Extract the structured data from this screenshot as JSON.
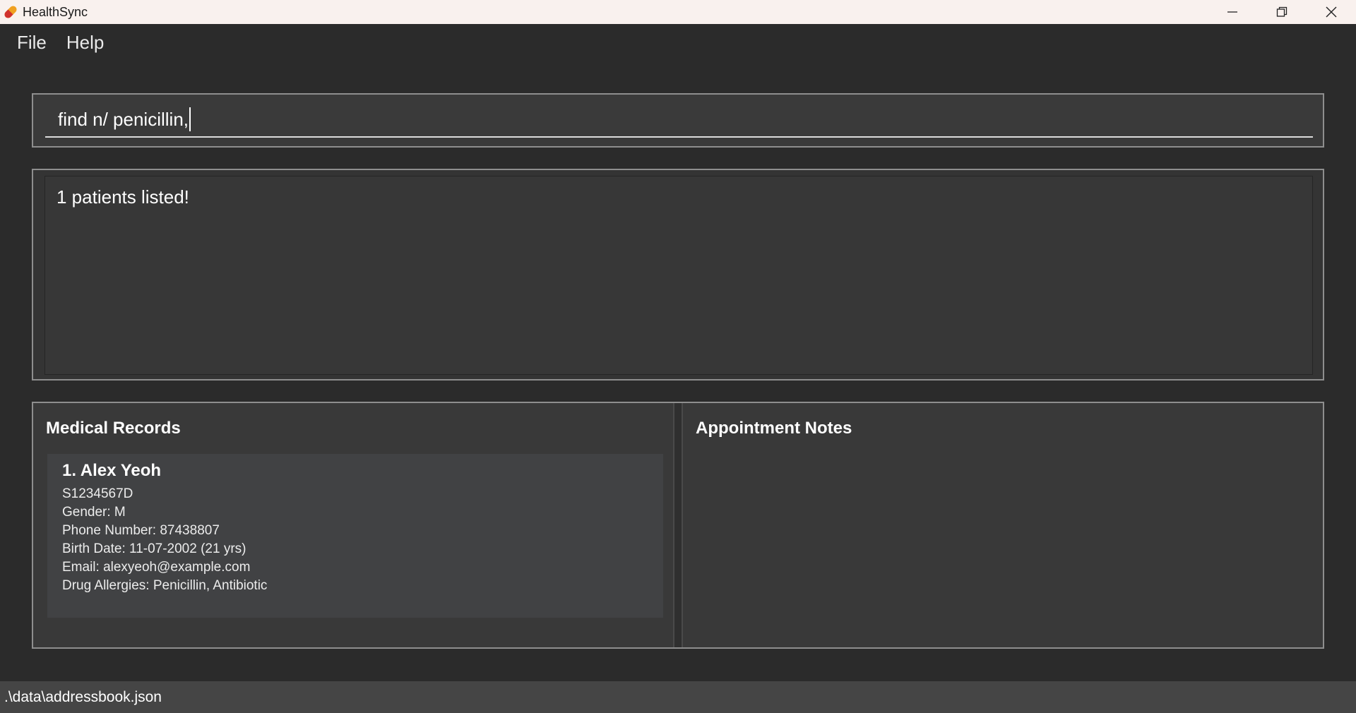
{
  "window": {
    "title": "HealthSync",
    "app_icon": "pill-icon",
    "controls": [
      "minimize-icon",
      "restore-icon",
      "close-icon"
    ]
  },
  "menu": {
    "file": "File",
    "help": "Help"
  },
  "command": {
    "value": "find n/ penicillin,"
  },
  "result": {
    "message": "1 patients listed!"
  },
  "panels": {
    "medical_records_title": "Medical Records",
    "appointment_notes_title": "Appointment Notes"
  },
  "patients": [
    {
      "index_name": "1.  Alex Yeoh",
      "nric": "S1234567D",
      "gender": "Gender: M",
      "phone": "Phone Number: 87438807",
      "birth": "Birth Date: 11-07-2002 (21 yrs)",
      "email": "Email: alexyeoh@example.com",
      "allergies": "Drug Allergies: Penicillin, Antibiotic"
    }
  ],
  "status": {
    "path": ".\\data\\addressbook.json"
  },
  "colors": {
    "background": "#2b2b2b",
    "titlebar": "#f9f1ee",
    "card": "#414244",
    "status_bar": "#454545"
  }
}
